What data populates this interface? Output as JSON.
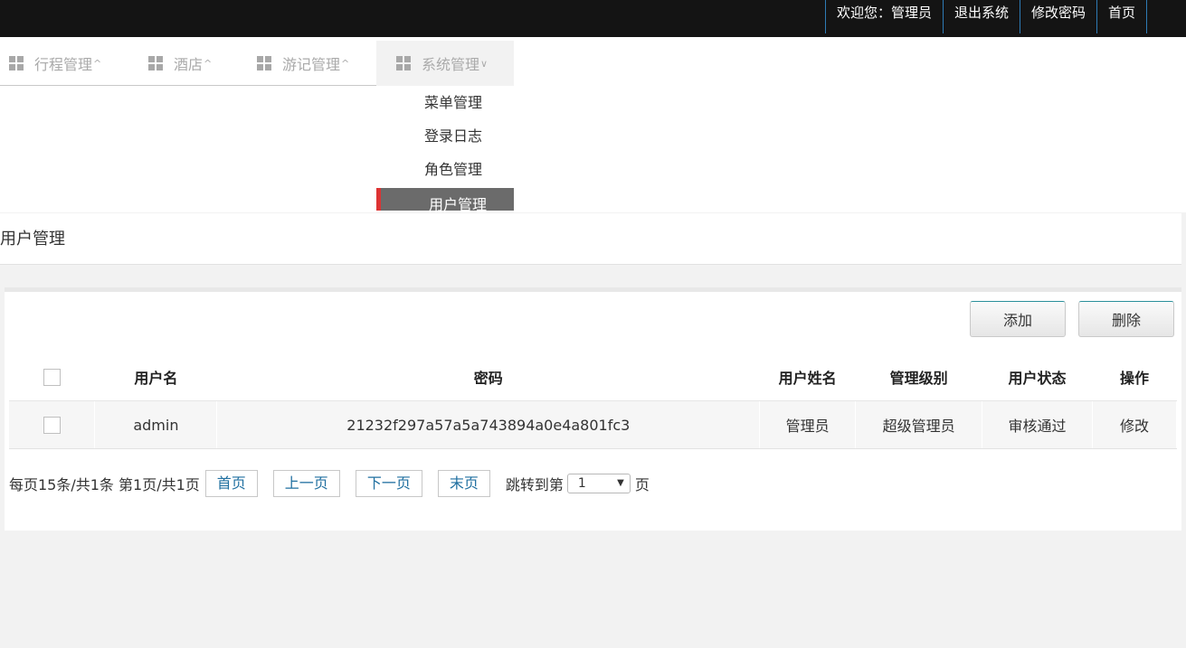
{
  "topnav": {
    "welcome": "欢迎您：管理员",
    "logout": "退出系统",
    "change_password": "修改密码",
    "home": "首页"
  },
  "menu": {
    "items": [
      {
        "label": "行程管理",
        "chevron": "^"
      },
      {
        "label": "酒店",
        "chevron": "^"
      },
      {
        "label": "游记管理",
        "chevron": "^"
      },
      {
        "label": "系统管理",
        "chevron": "∨"
      }
    ],
    "dropdown": [
      "菜单管理",
      "登录日志",
      "角色管理",
      "用户管理"
    ]
  },
  "page": {
    "title": "用户管理"
  },
  "toolbar": {
    "add_label": "添加",
    "delete_label": "删除"
  },
  "table": {
    "headers": [
      "用户名",
      "密码",
      "用户姓名",
      "管理级别",
      "用户状态",
      "操作"
    ],
    "rows": [
      {
        "username": "admin",
        "password": "21232f297a57a5a743894a0e4a801fc3",
        "name": "管理员",
        "level": "超级管理员",
        "status": "审核通过",
        "action": "修改"
      }
    ]
  },
  "pager": {
    "summary": "每页15条/共1条 第1页/共1页",
    "first": "首页",
    "prev": "上一页",
    "next": "下一页",
    "last": "末页",
    "jump_label": "跳转到第",
    "page_value": "1",
    "page_unit": "页"
  }
}
